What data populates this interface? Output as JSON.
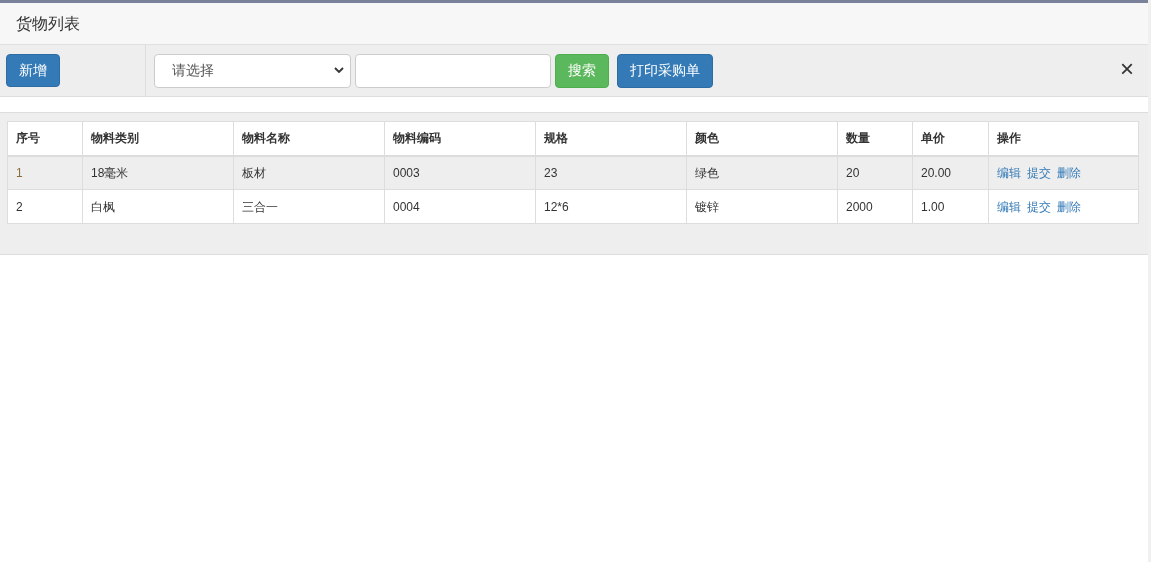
{
  "dialog": {
    "title": "货物列表"
  },
  "toolbar": {
    "add_button": "新增",
    "select": {
      "value": "请选择"
    },
    "search_button": "搜索",
    "print_button": "打印采购单",
    "close": "×"
  },
  "table": {
    "columns": [
      "序号",
      "物料类别",
      "物料名称",
      "物料编码",
      "规格",
      "颜色",
      "数量",
      "单价",
      "操作"
    ],
    "rows": [
      {
        "selected": true,
        "cells": [
          "1",
          "18毫米",
          "板材",
          "0003",
          "23",
          "绿色",
          "20",
          "20.00"
        ],
        "actions": [
          "编辑",
          "提交",
          "删除"
        ]
      },
      {
        "selected": false,
        "cells": [
          "2",
          "白枫",
          "三合一",
          "0004",
          "12*6",
          "镀锌",
          "2000",
          "1.00"
        ],
        "actions": [
          "编辑",
          "提交",
          "删除"
        ]
      }
    ]
  }
}
